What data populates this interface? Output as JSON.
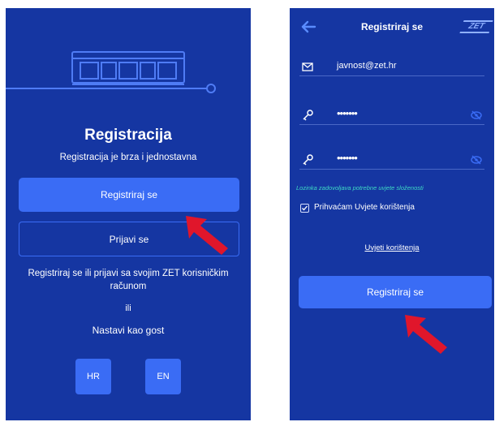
{
  "colors": {
    "screen_bg": "#1536a2",
    "button": "#3a6cf5",
    "accent_hint": "#3ed9c4",
    "arrow": "#e0162b"
  },
  "left_screen": {
    "title": "Registracija",
    "subtitle": "Registracija je brza i jednostavna",
    "register_button": "Registriraj se",
    "login_button": "Prijavi se",
    "info_text": "Registriraj se ili prijavi sa svojim ZET korisničkim računom",
    "or_text": "ili",
    "guest_link": "Nastavi kao gost",
    "languages": [
      "HR",
      "EN"
    ]
  },
  "right_screen": {
    "header_title": "Registriraj se",
    "logo_text": "ZET",
    "email_value": "javnost@zet.hr",
    "password_mask": "•••••••",
    "confirm_mask": "•••••••",
    "password_hint": "Lozinka zadovoljava potrebne uvjete složenosti",
    "terms_checkbox_label": "Prihvaćam Uvjete korištenja",
    "terms_checked": true,
    "terms_link": "Uvjeti korištenja",
    "register_button": "Registriraj se"
  },
  "icons": [
    "tram-illustration",
    "back-arrow-icon",
    "zet-logo-icon",
    "mail-icon",
    "key-icon",
    "eye-off-icon",
    "check-icon",
    "pointer-arrow"
  ]
}
